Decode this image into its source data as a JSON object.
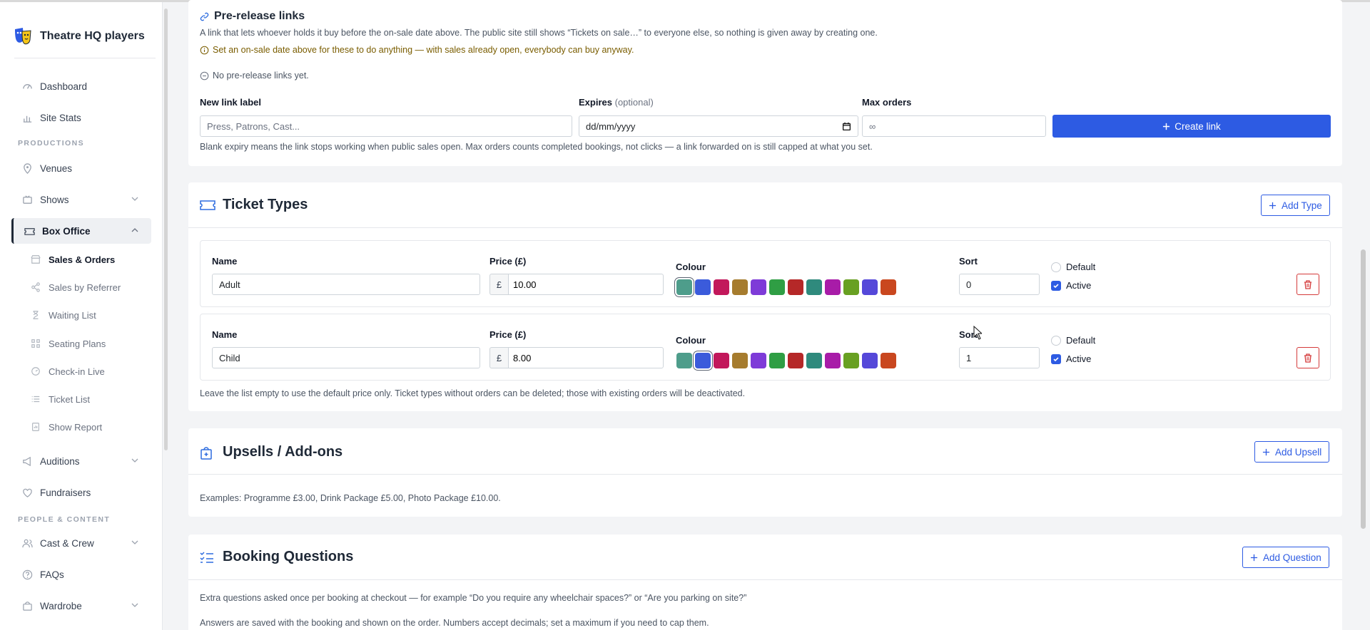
{
  "brand": {
    "name": "Theatre HQ players"
  },
  "sidebar": {
    "items": [
      {
        "label": "Dashboard",
        "icon": "dashboard-icon"
      },
      {
        "label": "Site Stats",
        "icon": "stats-icon"
      },
      {
        "label": "Venues",
        "icon": "location-icon"
      },
      {
        "label": "Shows",
        "icon": "shows-icon"
      },
      {
        "label": "Box Office",
        "icon": "ticket-icon"
      },
      {
        "label": "Auditions",
        "icon": "megaphone-icon"
      },
      {
        "label": "Fundraisers",
        "icon": "heart-icon"
      },
      {
        "label": "Cast & Crew",
        "icon": "people-icon"
      },
      {
        "label": "FAQs",
        "icon": "question-icon"
      },
      {
        "label": "Wardrobe",
        "icon": "bag-icon"
      }
    ],
    "sections": [
      "PRODUCTIONS",
      "PEOPLE & CONTENT"
    ],
    "box_office_sub": [
      {
        "label": "Sales & Orders"
      },
      {
        "label": "Sales by Referrer"
      },
      {
        "label": "Waiting List"
      },
      {
        "label": "Seating Plans"
      },
      {
        "label": "Check-in Live"
      },
      {
        "label": "Ticket List"
      },
      {
        "label": "Show Report"
      }
    ]
  },
  "prerelease": {
    "title": "Pre-release links",
    "description": "A link that lets whoever holds it buy before the on-sale date above. The public site still shows “Tickets on sale…” to everyone else, so nothing is given away by creating one.",
    "warning": "Set an on-sale date above for these to do anything — with sales already open, everybody can buy anyway.",
    "empty": "No pre-release links yet.",
    "label_label": "New link label",
    "label_placeholder": "Press, Patrons, Cast...",
    "expires_label": "Expires",
    "expires_optional": "(optional)",
    "expires_placeholder": "dd/mm/yyyy",
    "max_label": "Max orders",
    "max_placeholder": "∞",
    "create_button": "Create link",
    "help": "Blank expiry means the link stops working when public sales open. Max orders counts completed bookings, not clicks — a link forwarded on is still capped at what you set."
  },
  "ticket_types": {
    "title": "Ticket Types",
    "add_button": "Add Type",
    "col_name": "Name",
    "col_price": "Price (£)",
    "col_colour": "Colour",
    "col_sort": "Sort",
    "currency": "£",
    "default_label": "Default",
    "active_label": "Active",
    "palette": [
      "#4e9d8b",
      "#3b5bdb",
      "#c2185b",
      "#a67c2e",
      "#7e3bd8",
      "#2f9e44",
      "#b52828",
      "#2f8a7d",
      "#a81ca8",
      "#68a022",
      "#5548d9",
      "#c9471f"
    ],
    "rows": [
      {
        "name": "Adult",
        "price": "10.00",
        "sort": "0",
        "selected": 0
      },
      {
        "name": "Child",
        "price": "8.00",
        "sort": "1",
        "selected": 1
      }
    ],
    "help": "Leave the list empty to use the default price only. Ticket types without orders can be deleted; those with existing orders will be deactivated."
  },
  "upsells": {
    "title": "Upsells / Add-ons",
    "add_button": "Add Upsell",
    "examples": "Examples: Programme £3.00, Drink Package £5.00, Photo Package £10.00."
  },
  "booking_questions": {
    "title": "Booking Questions",
    "add_button": "Add Question",
    "desc1": "Extra questions asked once per booking at checkout — for example “Do you require any wheelchair spaces?” or “Are you parking on site?”",
    "desc2": "Answers are saved with the booking and shown on the order. Numbers accept decimals; set a maximum if you need to cap them."
  }
}
